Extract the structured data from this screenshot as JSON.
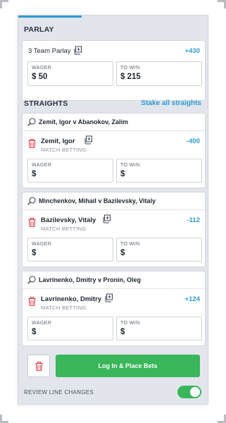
{
  "parlay": {
    "section_title": "PARLAY",
    "label": "3 Team Parlay",
    "odds": "+430",
    "wager_label": "WAGER",
    "wager_value": "$ 50",
    "towin_label": "TO WIN",
    "towin_value": "$ 215"
  },
  "straights": {
    "section_title": "STRAIGHTS",
    "stake_all_label": "Stake all straights",
    "bets": [
      {
        "matchup": "Zemit, Igor v Abanokov, Zalim",
        "selection": "Zemit, Igor",
        "market": "MATCH BETTING",
        "odds": "-400",
        "wager_label": "WAGER",
        "wager_value": "$",
        "towin_label": "TO WIN",
        "towin_value": "$"
      },
      {
        "matchup": "Minchenkov, Mihail v Bazilevsky, Vitaly",
        "selection": "Bazilevsky, Vitaly",
        "market": "MATCH BETTING",
        "odds": "-112",
        "wager_label": "WAGER",
        "wager_value": "$",
        "towin_label": "TO WIN",
        "towin_value": "$"
      },
      {
        "matchup": "Lavrinenko, Dmitry v Pronin, Oleg",
        "selection": "Lavrinenko, Dmitry",
        "market": "MATCH BETTING",
        "odds": "+124",
        "wager_label": "WAGER",
        "wager_value": "$",
        "towin_label": "TO WIN",
        "towin_value": "$"
      }
    ]
  },
  "footer": {
    "place_bets_label": "Log In & Place Bets",
    "review_label": "REVIEW LINE CHANGES",
    "review_enabled": true
  },
  "icons": {
    "sport": "ping-pong-paddle-icon",
    "parlay_marker": "parlay-stack-icon",
    "remove": "trash-icon"
  },
  "colors": {
    "accent_blue": "#2e9bd6",
    "danger_red": "#d9363e",
    "success_green": "#3ab65b",
    "panel_bg": "#e2e5eb"
  }
}
